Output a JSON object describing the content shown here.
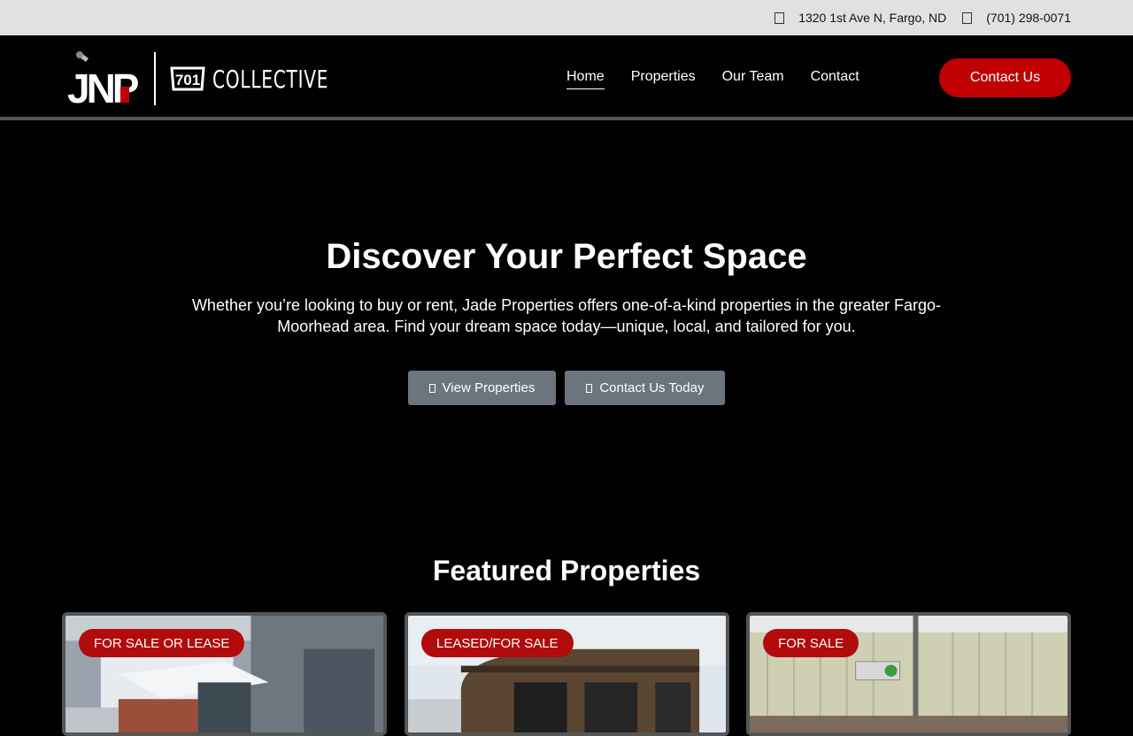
{
  "topbar": {
    "address": "1320 1st Ave N, Fargo, ND",
    "phone": "(701) 298-0071"
  },
  "logo": {
    "primary": "JNP",
    "badge": "701",
    "secondary": "COLLECTIVE"
  },
  "nav": {
    "items": [
      {
        "label": "Home",
        "active": true
      },
      {
        "label": "Properties",
        "active": false
      },
      {
        "label": "Our Team",
        "active": false
      },
      {
        "label": "Contact",
        "active": false
      }
    ],
    "cta_label": "Contact Us"
  },
  "hero": {
    "title": "Discover Your Perfect Space",
    "subtitle": "Whether you’re looking to buy or rent, Jade Properties offers one-of-a-kind properties in the greater Fargo-Moorhead area. Find your dream space today—unique, local, and tailored for you.",
    "buttons": [
      {
        "label": "View Properties",
        "icon": "building-icon"
      },
      {
        "label": "Contact Us Today",
        "icon": "phone-icon"
      }
    ]
  },
  "featured": {
    "title": "Featured Properties",
    "cards": [
      {
        "tag": "FOR SALE OR LEASE"
      },
      {
        "tag": "LEASED/FOR SALE"
      },
      {
        "tag": "FOR SALE"
      }
    ]
  },
  "colors": {
    "accent_red": "#c00000",
    "tag_red": "#b10b0b",
    "button_gray": "#6c757d",
    "topbar_bg": "#e1e1e1"
  }
}
